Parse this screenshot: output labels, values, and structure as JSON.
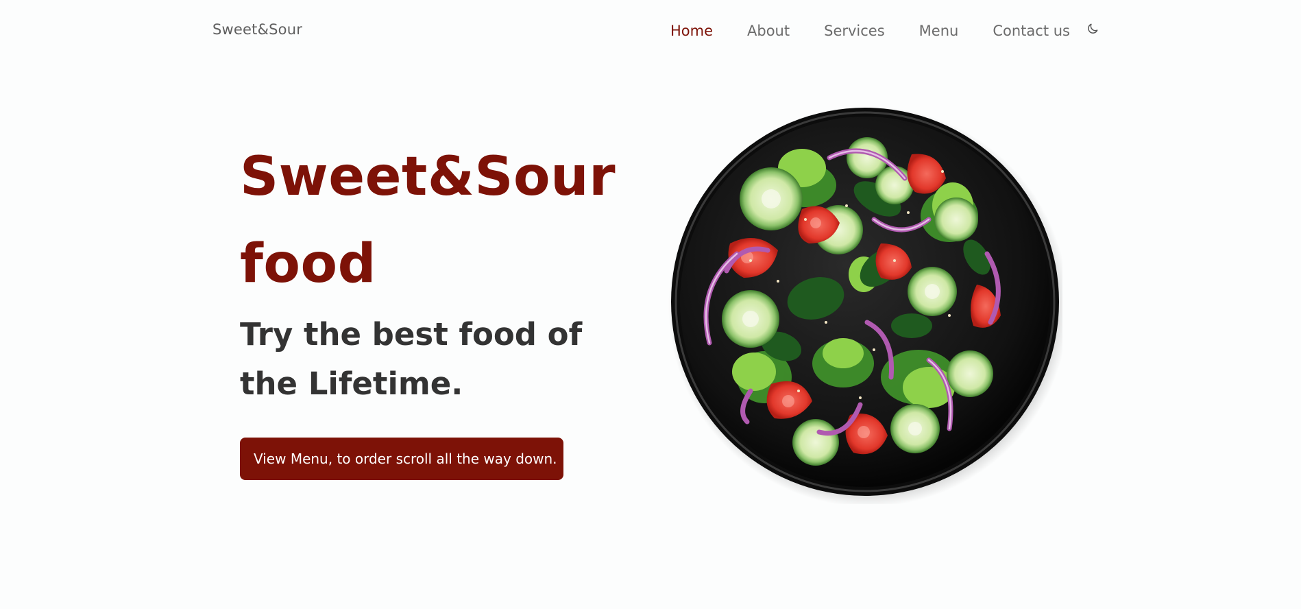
{
  "header": {
    "logo": "Sweet&Sour",
    "nav": [
      {
        "label": "Home",
        "active": true
      },
      {
        "label": "About",
        "active": false
      },
      {
        "label": "Services",
        "active": false
      },
      {
        "label": "Menu",
        "active": false
      },
      {
        "label": "Contact us",
        "active": false
      }
    ],
    "theme_icon": "moon-icon"
  },
  "hero": {
    "title_line1": "Sweet&Sour",
    "title_line2": "food",
    "subtitle": "Try the best food of the Lifetime.",
    "cta_label": "View Menu, to order scroll all the way down."
  },
  "image": {
    "subject": "salad-plate-image"
  },
  "colors": {
    "accent": "#7d1207",
    "text_dark": "#333333",
    "nav_text": "#6b6b6b",
    "background": "#fcfdfd"
  }
}
